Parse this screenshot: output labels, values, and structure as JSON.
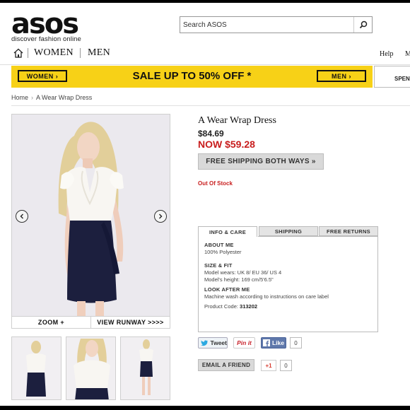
{
  "brand": {
    "logo": "asos",
    "tagline": "discover fashion online"
  },
  "search": {
    "placeholder": "Search ASOS"
  },
  "nav": {
    "women": "WOMEN",
    "men": "MEN",
    "help": "Help",
    "more": "M"
  },
  "banner": {
    "women_button": "WOMEN ›",
    "headline": "SALE UP TO 50% OFF *",
    "men_button": "MEN ›",
    "spend": "SPEN"
  },
  "breadcrumb": {
    "home": "Home",
    "separator": "›",
    "current": "A Wear Wrap Dress"
  },
  "image": {
    "zoom": "ZOOM +",
    "view_runway": "VIEW RUNWAY >>>>"
  },
  "product": {
    "title": "A Wear Wrap Dress",
    "old_price": "$84.69",
    "now_price": "NOW $59.28",
    "shipping_button": "FREE SHIPPING BOTH WAYS  »",
    "stock": "Out Of Stock"
  },
  "tabs": [
    {
      "label": "INFO & CARE"
    },
    {
      "label": "SHIPPING"
    },
    {
      "label": "FREE RETURNS"
    }
  ],
  "info": {
    "about_heading": "ABOUT ME",
    "about_text": "100% Polyester",
    "size_heading": "SIZE & FIT",
    "size_line1": "Model wears: UK 8/ EU 36/ US 4",
    "size_line2": "Model's height: 169 cm/5'6.5\"",
    "care_heading": "LOOK AFTER ME",
    "care_text": "Machine wash according to instructions on care label",
    "code_label": "Product Code: ",
    "code_value": "313202"
  },
  "social": {
    "tweet": "Tweet",
    "pin": "Pin it",
    "like": "Like",
    "like_count": "0",
    "email": "EMAIL A FRIEND",
    "gplus": "+1",
    "gplus_count": "0"
  },
  "colors": {
    "sale_yellow": "#f7d117",
    "price_red": "#c81d1d",
    "navy_skirt": "#1c1f3e"
  }
}
